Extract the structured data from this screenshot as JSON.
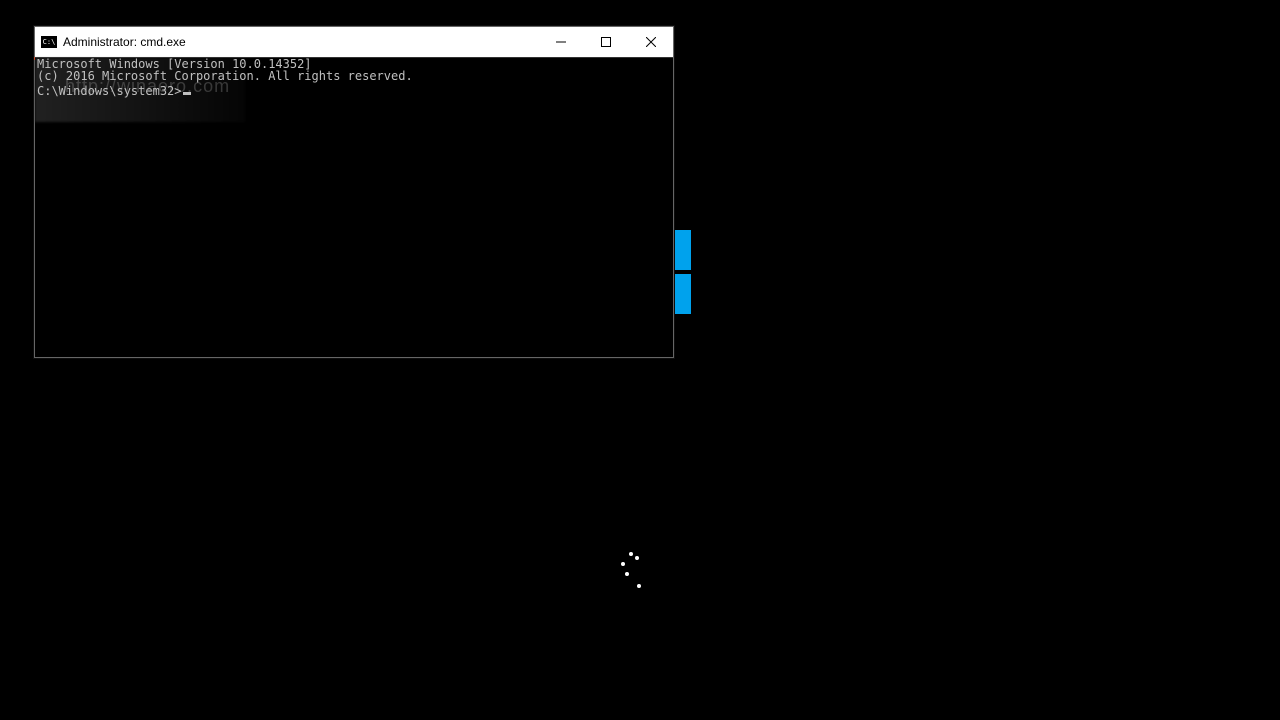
{
  "window": {
    "title": "Administrator: cmd.exe",
    "icon_label": "C:\\"
  },
  "console": {
    "line1": "Microsoft Windows [Version 10.0.14352]",
    "line2": "(c) 2016 Microsoft Corporation. All rights reserved.",
    "blank": "",
    "prompt": "C:\\Windows\\system32>"
  },
  "watermark": {
    "text": "http://winaero.com"
  },
  "colors": {
    "accent_cyan": "#00a2ed",
    "console_fg": "#c0c0c0"
  }
}
